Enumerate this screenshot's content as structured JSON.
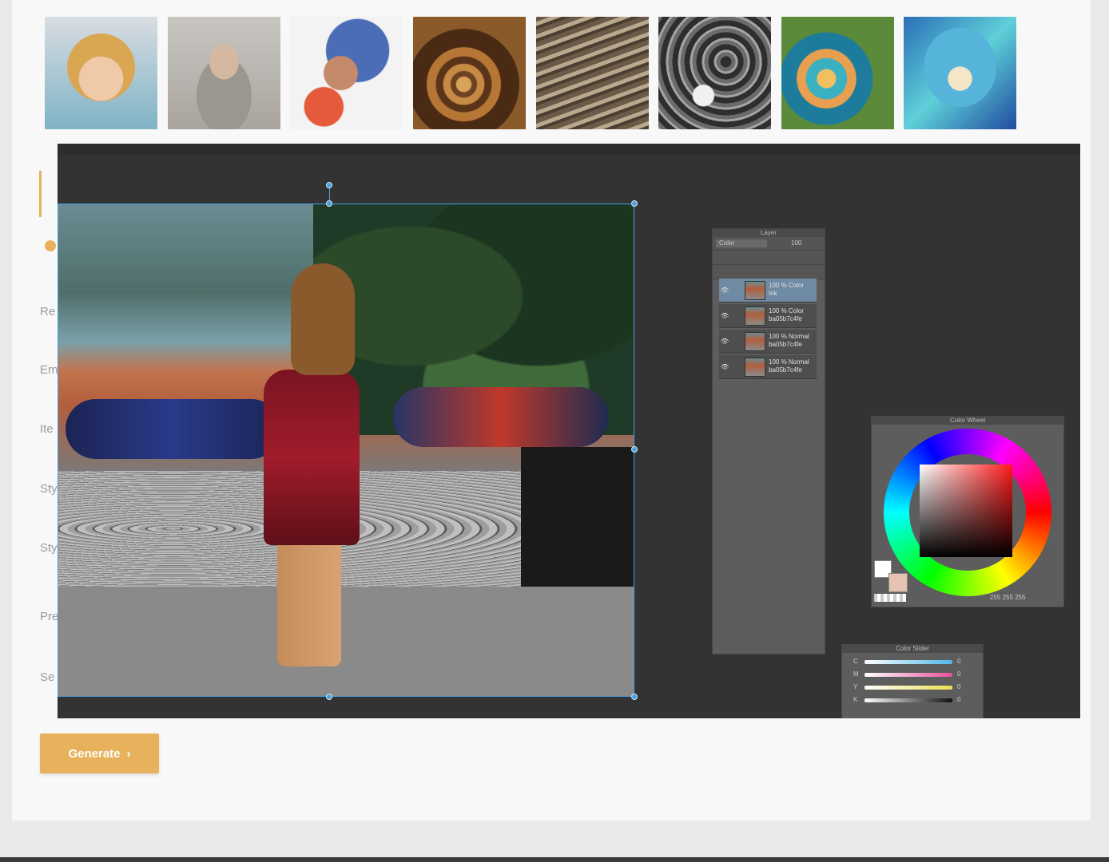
{
  "form": {
    "side_labels": [
      "Re",
      "Em",
      "Ite",
      "Sty",
      "Sty",
      "Pre",
      "Se"
    ],
    "generate_label": "Generate",
    "generate_icon": "chevron-right-icon"
  },
  "style_thumbnails": [
    {
      "name": "style-thumb-child-portrait"
    },
    {
      "name": "style-thumb-bearded-man"
    },
    {
      "name": "style-thumb-watercolor-christ"
    },
    {
      "name": "style-thumb-spiral-fractal"
    },
    {
      "name": "style-thumb-engraving"
    },
    {
      "name": "style-thumb-grey-swirls"
    },
    {
      "name": "style-thumb-blue-fractal"
    },
    {
      "name": "style-thumb-owl"
    }
  ],
  "editor": {
    "layer_panel": {
      "title": "Layer",
      "blend_mode": "Color",
      "opacity": "100",
      "layers": [
        {
          "line1": "100 % Color",
          "line2": "Ink"
        },
        {
          "line1": "100 % Color",
          "line2": "ba05b7c4fe"
        },
        {
          "line1": "100 % Normal",
          "line2": "ba05b7c4fe"
        },
        {
          "line1": "100 % Normal",
          "line2": "ba05b7c4fe"
        }
      ]
    },
    "color_wheel": {
      "title": "Color Wheel",
      "r": "255",
      "g": "255",
      "b": "255"
    },
    "color_slider": {
      "title": "Color Slider",
      "channels": [
        {
          "label": "C",
          "value": "0",
          "color": "#4fb7e8"
        },
        {
          "label": "M",
          "value": "0",
          "color": "#e84f9c"
        },
        {
          "label": "Y",
          "value": "0",
          "color": "#e8e04f"
        },
        {
          "label": "K",
          "value": "0",
          "color": "#dddddd"
        }
      ]
    }
  },
  "colors": {
    "accent": "#e7b25b",
    "editor_bg": "#333333",
    "selection": "#4aa0e0"
  }
}
